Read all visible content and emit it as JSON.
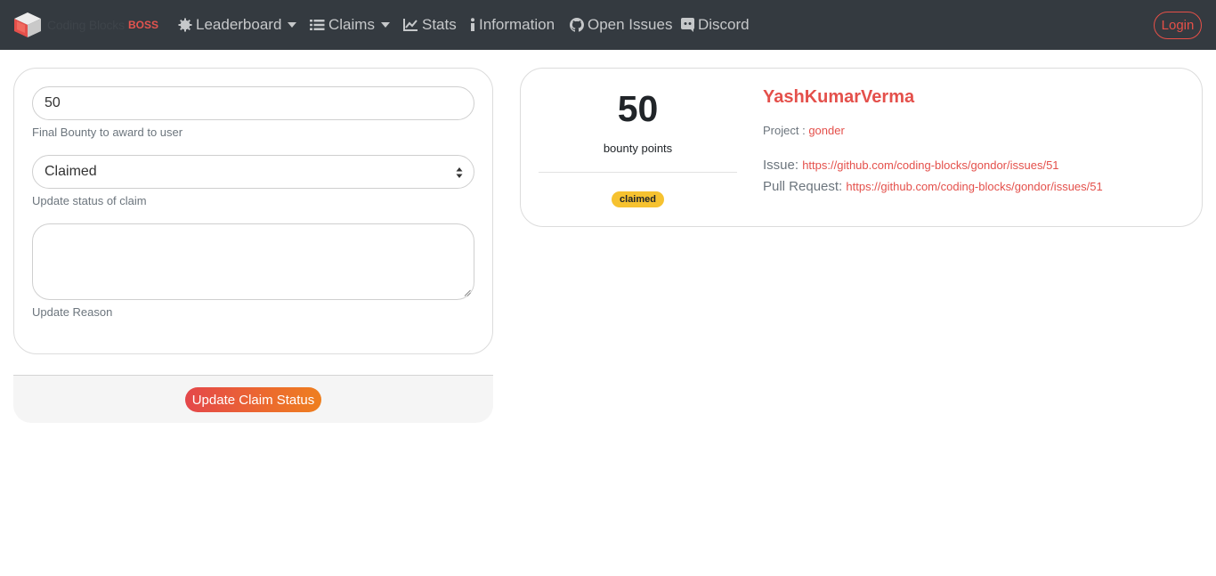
{
  "navbar": {
    "brand_name": "Coding Blocks",
    "brand_tag": "BOSS",
    "items": [
      {
        "label": "Leaderboard",
        "icon": "gear-icon",
        "dropdown": true
      },
      {
        "label": "Claims",
        "icon": "list-icon",
        "dropdown": true
      },
      {
        "label": "Stats",
        "icon": "chart-line-icon",
        "dropdown": false
      },
      {
        "label": "Information",
        "icon": "info-icon",
        "dropdown": false
      },
      {
        "label": "Open Issues",
        "icon": "github-icon",
        "dropdown": false
      },
      {
        "label": "Discord",
        "icon": "discord-icon",
        "dropdown": false
      }
    ],
    "login_label": "Login"
  },
  "form": {
    "bounty_value": "50",
    "bounty_help": "Final Bounty to award to user",
    "status_value": "Claimed",
    "status_help": "Update status of claim",
    "reason_value": "",
    "reason_help": "Update Reason",
    "submit_label": "Update Claim Status"
  },
  "claim": {
    "points": "50",
    "points_label": "bounty points",
    "status": "claimed",
    "user": "YashKumarVerma",
    "project_label": "Project :",
    "project": "gonder",
    "issue_label": "Issue:",
    "issue_url": "https://github.com/coding-blocks/gondor/issues/51",
    "pr_label": "Pull Request:",
    "pr_url": "https://github.com/coding-blocks/gondor/issues/51"
  },
  "colors": {
    "navbar_bg": "#343a40",
    "accent": "#e4504b",
    "badge": "#f6c230"
  }
}
